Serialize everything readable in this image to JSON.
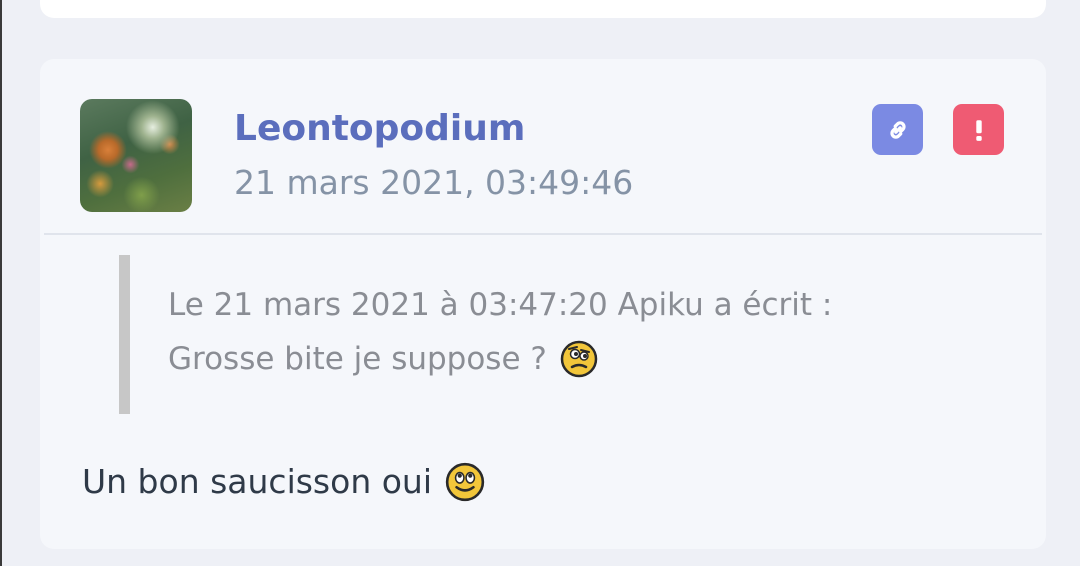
{
  "post": {
    "username": "Leontopodium",
    "timestamp": "21 mars 2021, 03:49:46",
    "avatar_icon": "avatar-image",
    "actions": {
      "link_icon": "link-icon",
      "report_icon": "exclamation-icon"
    },
    "quote": {
      "header": "Le 21 mars 2021 à 03:47:20 Apiku a écrit :",
      "text": "Grosse bite je suppose ?",
      "smiley": "suspicious-smiley-icon"
    },
    "body": {
      "text": "Un bon saucisson oui",
      "smiley": "smiley-icon"
    }
  },
  "colors": {
    "username": "#5b6ebd",
    "link_button": "#7b8ae3",
    "report_button": "#ef5b73",
    "quote_bar": "#c7c7c7"
  }
}
